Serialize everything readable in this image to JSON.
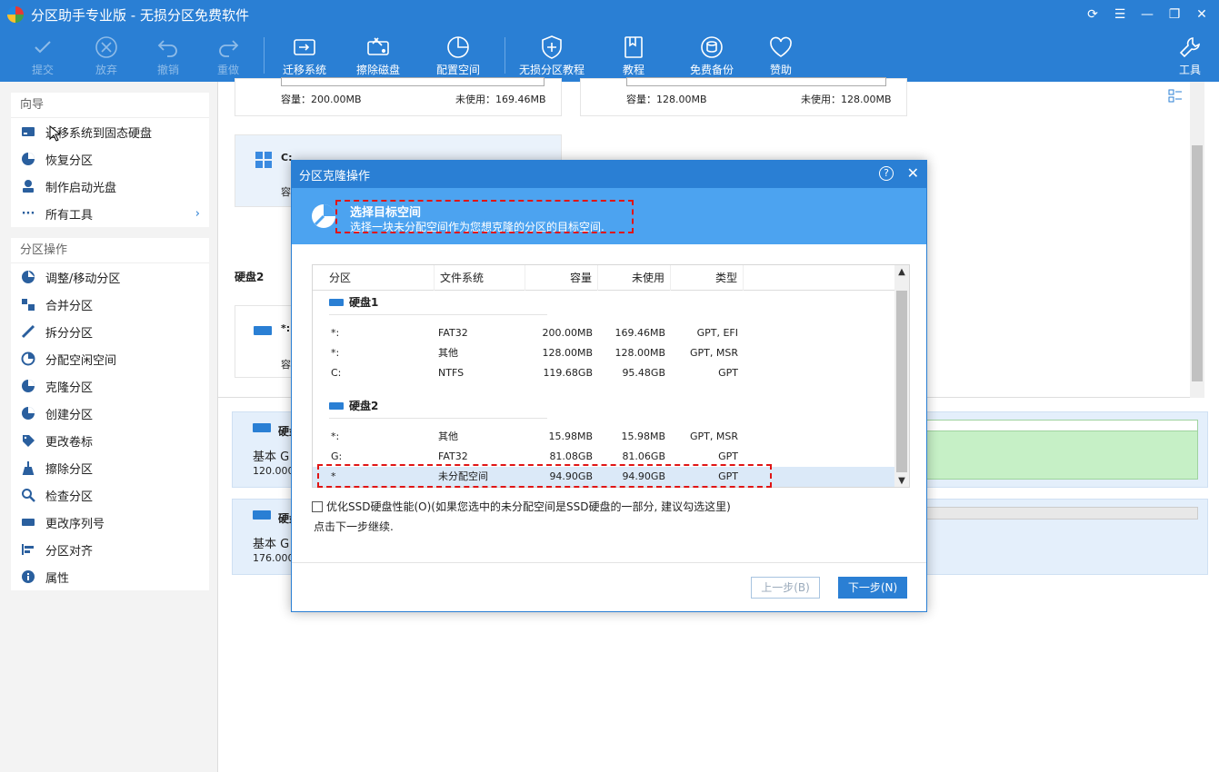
{
  "app": {
    "title": "分区助手专业版 - 无损分区免费软件"
  },
  "toolbar": {
    "commit": "提交",
    "discard": "放弃",
    "undo": "撤销",
    "redo": "重做",
    "migrate": "迁移系统",
    "wipe": "擦除磁盘",
    "allocate": "配置空间",
    "tutorial_lossless": "无损分区教程",
    "tutorial": "教程",
    "backup": "免费备份",
    "donate": "赞助",
    "tools": "工具"
  },
  "wizard": {
    "title": "向导",
    "items": [
      {
        "label": "迁移系统到固态硬盘",
        "icon": "migrate-icon"
      },
      {
        "label": "恢复分区",
        "icon": "restore-icon"
      },
      {
        "label": "制作启动光盘",
        "icon": "bootdisk-icon"
      },
      {
        "label": "所有工具",
        "icon": "more-icon"
      }
    ]
  },
  "ops": {
    "title": "分区操作",
    "items": [
      {
        "label": "调整/移动分区"
      },
      {
        "label": "合并分区"
      },
      {
        "label": "拆分分区"
      },
      {
        "label": "分配空闲空间"
      },
      {
        "label": "克隆分区"
      },
      {
        "label": "创建分区"
      },
      {
        "label": "更改卷标"
      },
      {
        "label": "擦除分区"
      },
      {
        "label": "检查分区"
      },
      {
        "label": "更改序列号"
      },
      {
        "label": "分区对齐"
      },
      {
        "label": "属性"
      }
    ]
  },
  "main": {
    "card1": {
      "capacity": "容量：200.00MB",
      "unused": "未使用：169.46MB"
    },
    "card2": {
      "capacity": "容量：128.00MB",
      "unused": "未使用：128.00MB"
    },
    "card3": {
      "letter": "C:",
      "cap_prefix": "容"
    },
    "disk2_label": "硬盘2",
    "card4": {
      "letter": "*:",
      "cap_prefix": "容"
    },
    "dcard1": {
      "name": "硬盘",
      "type": "基本 G",
      "size": "120.000"
    },
    "dcard2": {
      "name": "硬盘",
      "type": "基本 G",
      "size": "176.000"
    }
  },
  "dialog": {
    "title": "分区克隆操作",
    "help": "?",
    "heading": "选择目标空间",
    "subheading": "选择一块未分配空间作为您想克隆的分区的目标空间.",
    "columns": {
      "partition": "分区",
      "fs": "文件系统",
      "capacity": "容量",
      "unused": "未使用",
      "type": "类型"
    },
    "disk1": {
      "name": "硬盘1",
      "rows": [
        {
          "part": "*:",
          "fs": "FAT32",
          "cap": "200.00MB",
          "free": "169.46MB",
          "type": "GPT, EFI"
        },
        {
          "part": "*:",
          "fs": "其他",
          "cap": "128.00MB",
          "free": "128.00MB",
          "type": "GPT, MSR"
        },
        {
          "part": "C:",
          "fs": "NTFS",
          "cap": "119.68GB",
          "free": "95.48GB",
          "type": "GPT"
        }
      ]
    },
    "disk2": {
      "name": "硬盘2",
      "rows": [
        {
          "part": "*:",
          "fs": "其他",
          "cap": "15.98MB",
          "free": "15.98MB",
          "type": "GPT, MSR"
        },
        {
          "part": "G:",
          "fs": "FAT32",
          "cap": "81.08GB",
          "free": "81.06GB",
          "type": "GPT"
        },
        {
          "part": "*",
          "fs": "未分配空间",
          "cap": "94.90GB",
          "free": "94.90GB",
          "type": "GPT"
        }
      ]
    },
    "ssd_option": "优化SSD硬盘性能(O)(如果您选中的未分配空间是SSD硬盘的一部分, 建议勾选这里)",
    "hint": "点击下一步继续.",
    "prev": "上一步(B)",
    "next": "下一步(N)"
  },
  "colors": {
    "accent": "#2a7fd4",
    "header": "#4ca3f0",
    "highlight": "#e01515"
  }
}
